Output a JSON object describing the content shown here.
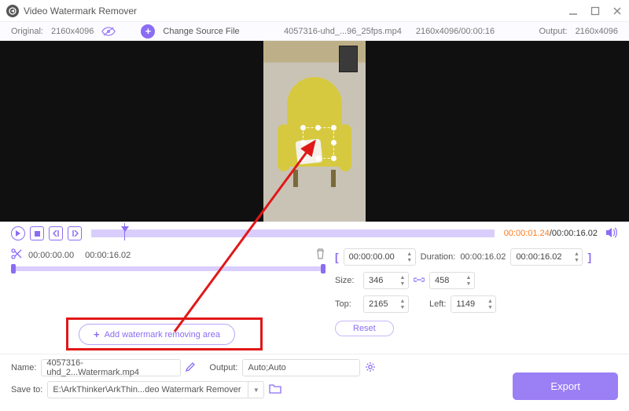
{
  "titlebar": {
    "title": "Video Watermark Remover"
  },
  "infobar": {
    "original_label": "Original:",
    "original_value": "2160x4096",
    "change_label": "Change Source File",
    "filename": "4057316-uhd_...96_25fps.mp4",
    "file_meta": "2160x4096/00:00:16",
    "output_label": "Output:",
    "output_value": "2160x4096"
  },
  "player": {
    "current": "00:00:01.24",
    "total": "00:00:16.02"
  },
  "range": {
    "start": "00:00:00.00",
    "end": "00:00:16.02"
  },
  "area": {
    "bracket_start": "00:00:00.00",
    "duration_label": "Duration:",
    "duration_value": "00:00:16.02",
    "bracket_end": "00:00:16.02",
    "size_label": "Size:",
    "size_w": "346",
    "size_h": "458",
    "top_label": "Top:",
    "top_v": "2165",
    "left_label": "Left:",
    "left_v": "1149",
    "reset": "Reset",
    "add_label": "Add watermark removing area"
  },
  "bottom": {
    "name_label": "Name:",
    "name_value": "4057316-uhd_2...Watermark.mp4",
    "output_label": "Output:",
    "output_value": "Auto;Auto",
    "saveto_label": "Save to:",
    "saveto_value": "E:\\ArkThinker\\ArkThin...deo Watermark Remover",
    "export": "Export"
  }
}
